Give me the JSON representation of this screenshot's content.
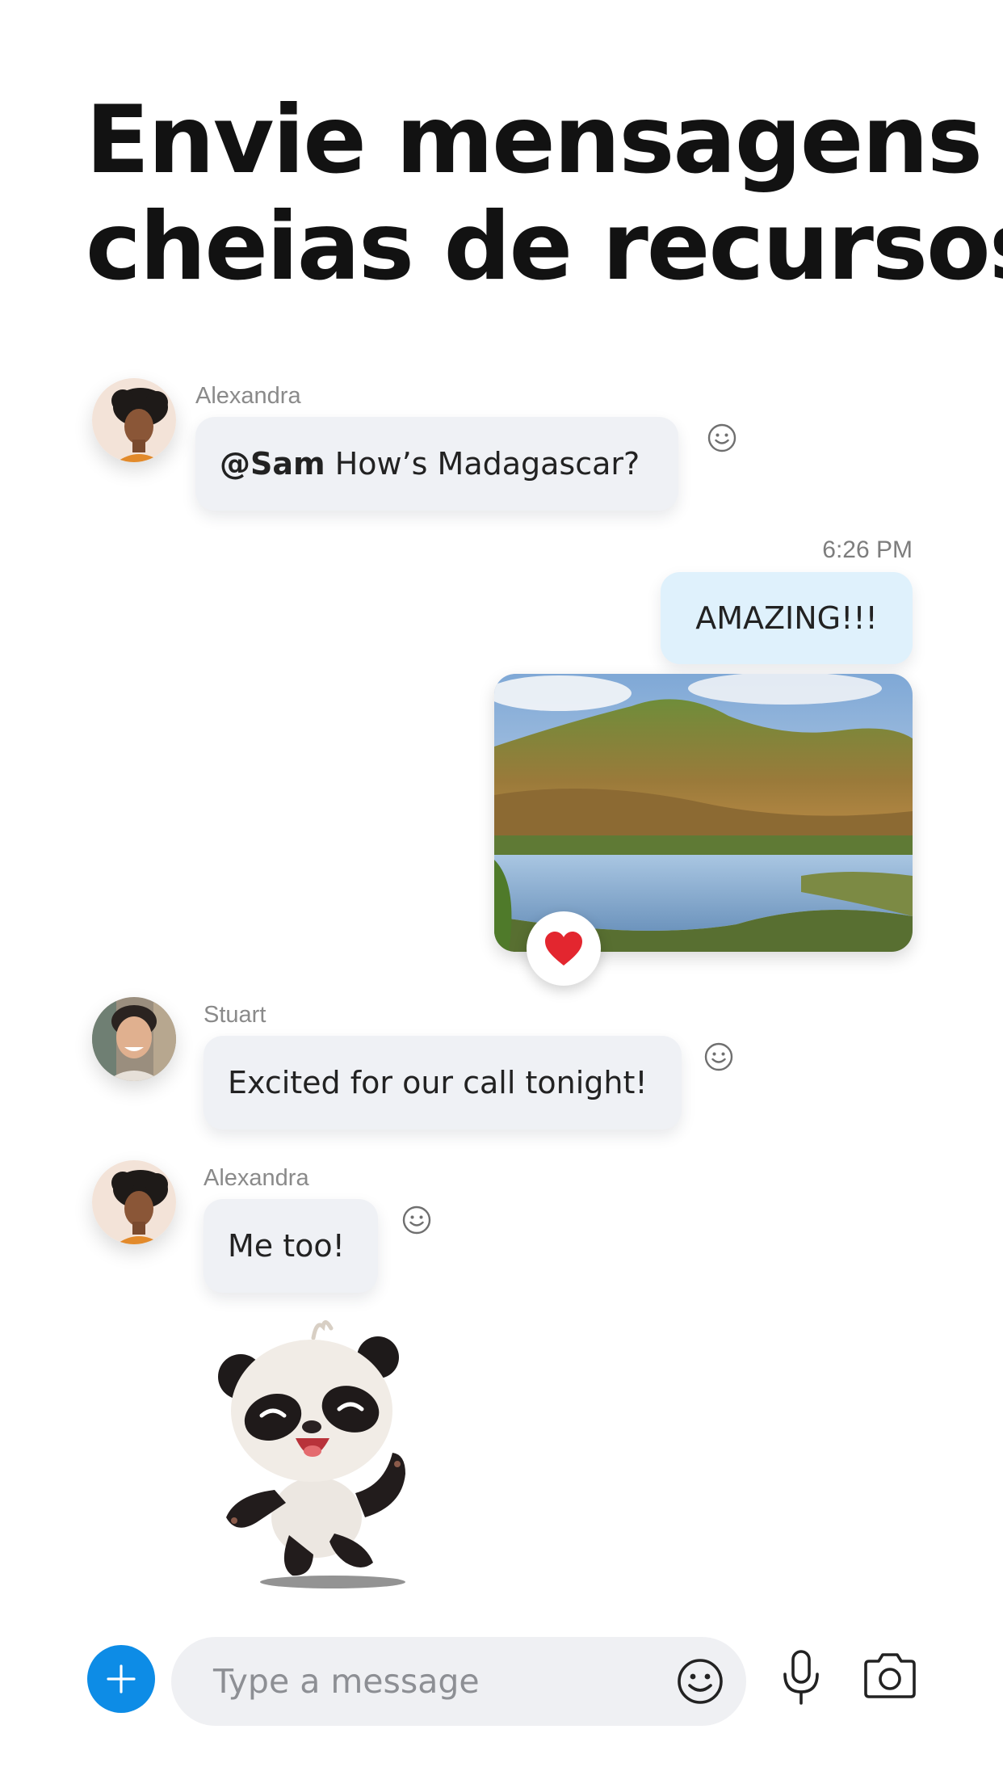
{
  "headline": {
    "line1": "Envie mensagens",
    "line2": "cheias de recursos"
  },
  "messages": [
    {
      "sender": "Alexandra",
      "mention": "@Sam",
      "text": " How’s Madagascar?"
    },
    {
      "time": "6:26 PM",
      "text": "AMAZING!!!",
      "reaction": "heart"
    },
    {
      "sender": "Stuart",
      "text": "Excited for our call tonight!"
    },
    {
      "sender": "Alexandra",
      "text": "Me too!",
      "sticker": "panda"
    }
  ],
  "composer": {
    "placeholder": "Type a message"
  },
  "colors": {
    "accent": "#0d8ce6",
    "incoming_bubble": "#eff1f5",
    "outgoing_bubble": "#dff1fc",
    "heart": "#e3262f"
  }
}
